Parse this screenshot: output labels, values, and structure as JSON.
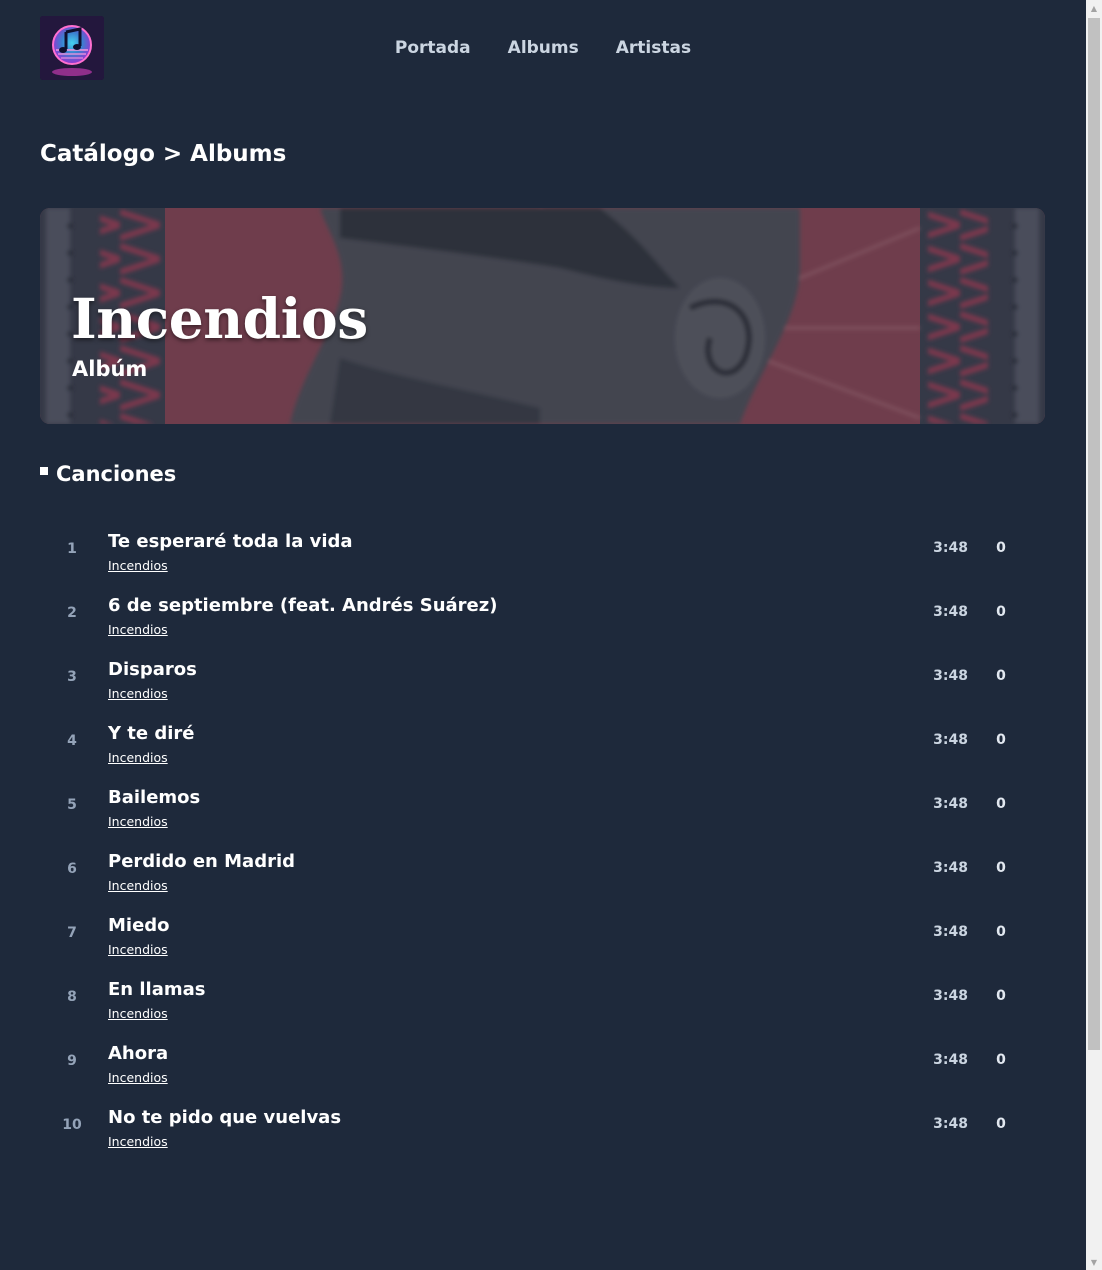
{
  "header": {
    "logo_icon": "music-note-logo-icon",
    "nav": [
      {
        "label": "Portada"
      },
      {
        "label": "Albums"
      },
      {
        "label": "Artistas"
      }
    ]
  },
  "breadcrumb": {
    "root": "Catálogo",
    "separator": ">",
    "current": "Albums"
  },
  "banner": {
    "title": "Incendios",
    "subtitle": "Albúm"
  },
  "section": {
    "heading": "Canciones"
  },
  "tracks": [
    {
      "num": "1",
      "title": "Te esperaré toda la vida",
      "album": "Incendios",
      "duration": "3:48",
      "plays": "0"
    },
    {
      "num": "2",
      "title": "6 de septiembre (feat. Andrés Suárez)",
      "album": "Incendios",
      "duration": "3:48",
      "plays": "0"
    },
    {
      "num": "3",
      "title": "Disparos",
      "album": "Incendios",
      "duration": "3:48",
      "plays": "0"
    },
    {
      "num": "4",
      "title": "Y te diré",
      "album": "Incendios",
      "duration": "3:48",
      "plays": "0"
    },
    {
      "num": "5",
      "title": "Bailemos",
      "album": "Incendios",
      "duration": "3:48",
      "plays": "0"
    },
    {
      "num": "6",
      "title": "Perdido en Madrid",
      "album": "Incendios",
      "duration": "3:48",
      "plays": "0"
    },
    {
      "num": "7",
      "title": "Miedo",
      "album": "Incendios",
      "duration": "3:48",
      "plays": "0"
    },
    {
      "num": "8",
      "title": "En llamas",
      "album": "Incendios",
      "duration": "3:48",
      "plays": "0"
    },
    {
      "num": "9",
      "title": "Ahora",
      "album": "Incendios",
      "duration": "3:48",
      "plays": "0"
    },
    {
      "num": "10",
      "title": "No te pido que vuelvas",
      "album": "Incendios",
      "duration": "3:48",
      "plays": "0"
    }
  ],
  "colors": {
    "background": "#1e293b",
    "nav_text": "#cbd5e1",
    "muted_text": "#94a3b8",
    "banner_red": "#a14a58"
  }
}
